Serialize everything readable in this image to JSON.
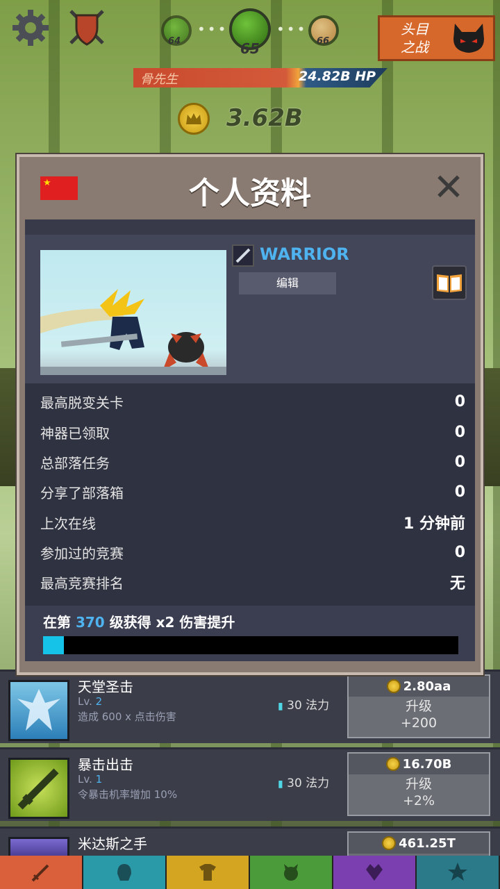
{
  "hud": {
    "stages": {
      "prev": "64",
      "current": "65",
      "next": "66"
    },
    "boss_button_label_line1": "头目",
    "boss_button_label_line2": "之战",
    "enemy_name": "骨先生",
    "enemy_hp": "24.82B HP",
    "gold": "3.62B"
  },
  "modal": {
    "title": "个人资料",
    "flag": "china-flag",
    "class_name": "WARRIOR",
    "edit_label": "编辑",
    "stats": [
      {
        "label": "最高脱变关卡",
        "value": "0"
      },
      {
        "label": "神器已领取",
        "value": "0"
      },
      {
        "label": "总部落任务",
        "value": "0"
      },
      {
        "label": "分享了部落箱",
        "value": "0"
      },
      {
        "label": "上次在线",
        "value": "1 分钟前"
      },
      {
        "label": "参加过的竞赛",
        "value": "0"
      },
      {
        "label": "最高竞赛排名",
        "value": "无"
      }
    ],
    "bonus": {
      "prefix": "在第",
      "level": "370",
      "suffix": "级获得 x2 伤害提升",
      "progress_fraction": 0.05
    }
  },
  "skills": [
    {
      "name": "天堂圣击",
      "lv_prefix": "Lv.",
      "lv": "2",
      "desc": "造成 600 x 点击伤害",
      "mana": "30 法力",
      "cost": "2.80aa",
      "upgrade": "升级",
      "gain": "+200"
    },
    {
      "name": "暴击出击",
      "lv_prefix": "Lv.",
      "lv": "1",
      "desc": "令暴击机率增加 10%",
      "mana": "30 法力",
      "cost": "16.70B",
      "upgrade": "升级",
      "gain": "+2%"
    },
    {
      "name": "米达斯之手",
      "cost": "461.25T"
    }
  ],
  "colors": {
    "accent": "#4fb3f0",
    "progress": "#15c3e8",
    "boss_button": "#d7682b"
  }
}
